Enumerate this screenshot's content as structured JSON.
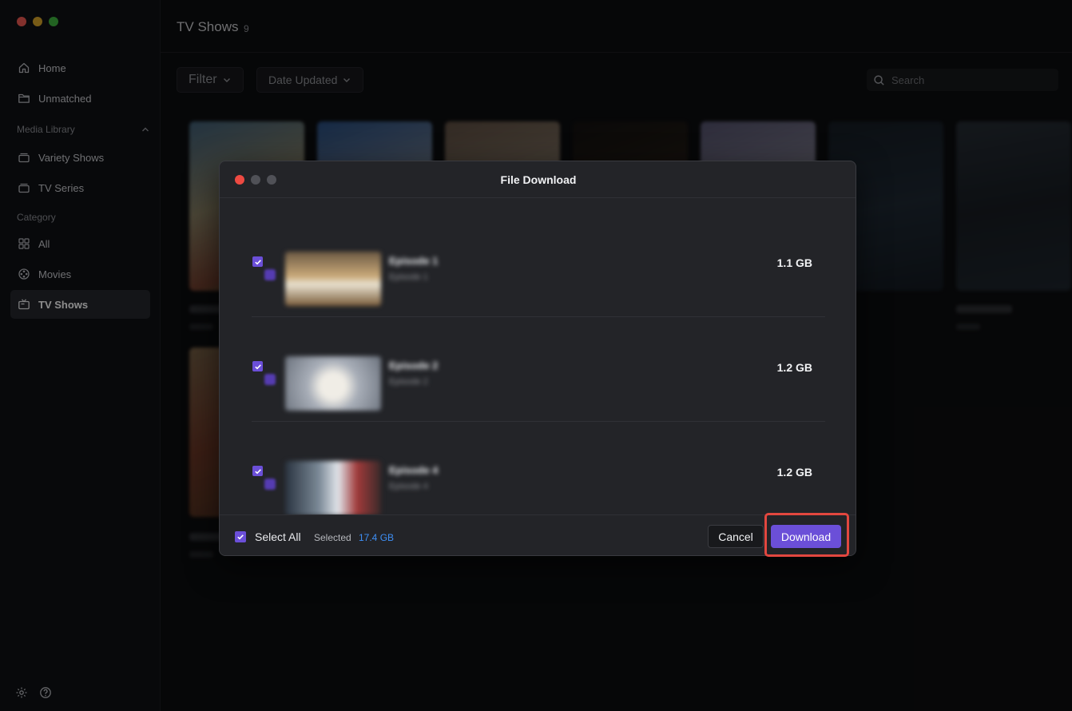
{
  "sidebar": {
    "traffic_colors": [
      "#ee5a52",
      "#d9a62a",
      "#3fb53f"
    ],
    "items": [
      {
        "label": "Home",
        "icon": "home-icon"
      },
      {
        "label": "Unmatched",
        "icon": "folder-icon"
      },
      {
        "label": "Variety Shows",
        "icon": "stack-icon"
      },
      {
        "label": "TV Series",
        "icon": "stack-icon"
      },
      {
        "label": "All",
        "icon": "grid-icon"
      },
      {
        "label": "Movies",
        "icon": "film-reel-icon"
      },
      {
        "label": "TV Shows",
        "icon": "tv-icon"
      }
    ],
    "section_media_library": "Media Library",
    "section_category": "Category",
    "active_item": "TV Shows",
    "bottom_icons": [
      "gear-icon",
      "help-icon"
    ]
  },
  "header": {
    "title": "TV Shows",
    "count": "9"
  },
  "toolbar": {
    "filter_label": "Filter",
    "sort_label": "Date Updated",
    "search_placeholder": "Search"
  },
  "modal": {
    "title": "File Download",
    "traffic_colors": [
      "#ee4a42",
      "#505157",
      "#505157"
    ],
    "episodes": [
      {
        "title": "Episode 1",
        "subtitle": "Episode 1",
        "size": "1.1 GB",
        "checked": true
      },
      {
        "title": "Episode 2",
        "subtitle": "Episode 2",
        "size": "1.2 GB",
        "checked": true
      },
      {
        "title": "Episode 4",
        "subtitle": "Episode 4",
        "size": "1.2 GB",
        "checked": true
      }
    ],
    "select_all_label": "Select All",
    "selected_label": "Selected",
    "selected_size": "17.4 GB",
    "cancel_label": "Cancel",
    "download_label": "Download"
  },
  "colors": {
    "accent": "#6b4fd8",
    "link": "#3e8ff5",
    "highlight": "#e2473f"
  }
}
